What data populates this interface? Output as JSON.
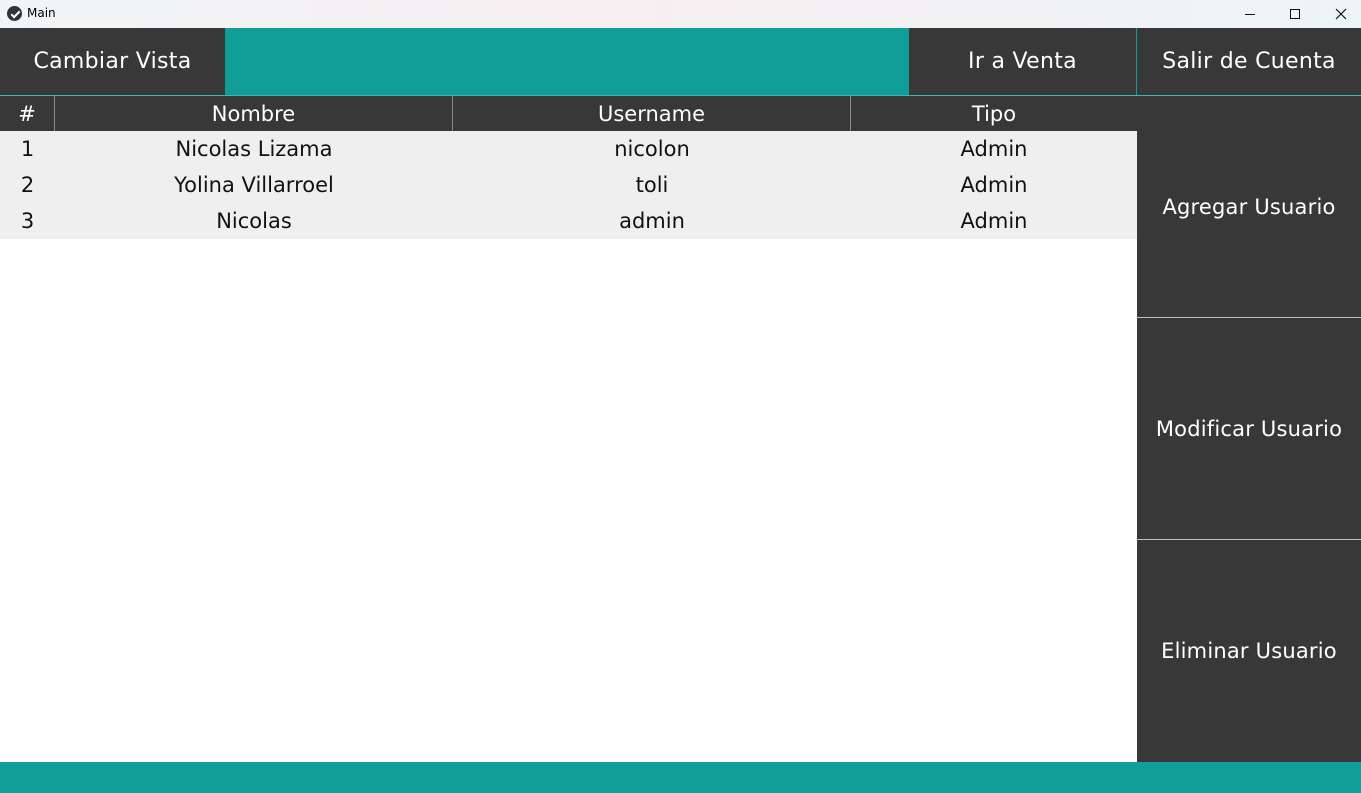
{
  "window": {
    "title": "Main"
  },
  "topbar": {
    "cambiar_vista": "Cambiar Vista",
    "ir_a_venta": "Ir a Venta",
    "salir_de_cuenta": "Salir de Cuenta"
  },
  "table": {
    "headers": [
      "#",
      "Nombre",
      "Username",
      "Tipo"
    ],
    "rows": [
      {
        "n": "1",
        "nombre": "Nicolas Lizama",
        "username": "nicolon",
        "tipo": "Admin"
      },
      {
        "n": "2",
        "nombre": "Yolina Villarroel",
        "username": "toli",
        "tipo": "Admin"
      },
      {
        "n": "3",
        "nombre": "Nicolas",
        "username": "admin",
        "tipo": "Admin"
      }
    ]
  },
  "side": {
    "agregar": "Agregar Usuario",
    "modificar": "Modificar Usuario",
    "eliminar": "Eliminar Usuario"
  },
  "colors": {
    "accent": "#129e98",
    "button_bg": "#383838",
    "row_bg": "#efefef"
  },
  "icons": {
    "app": "app-logo-icon",
    "minimize": "minimize-icon",
    "maximize": "maximize-icon",
    "close": "close-icon"
  }
}
